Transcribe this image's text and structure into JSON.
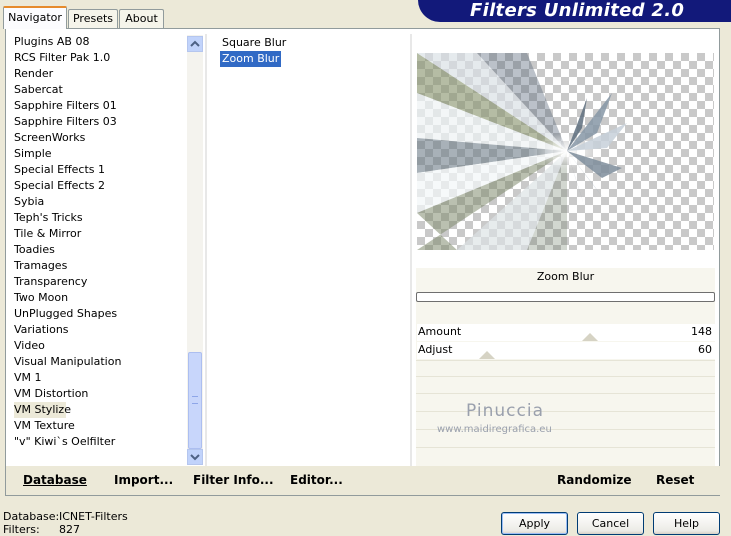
{
  "tabs": [
    {
      "label": "Navigator",
      "active": true
    },
    {
      "label": "Presets",
      "active": false
    },
    {
      "label": "About",
      "active": false
    }
  ],
  "brand_title": "Filters Unlimited 2.0",
  "categories": [
    {
      "label": "Plugins AB 08"
    },
    {
      "label": "RCS Filter Pak 1.0"
    },
    {
      "label": "Render"
    },
    {
      "label": "Sabercat"
    },
    {
      "label": "Sapphire Filters 01"
    },
    {
      "label": "Sapphire Filters 03"
    },
    {
      "label": "ScreenWorks"
    },
    {
      "label": "Simple"
    },
    {
      "label": "Special Effects 1"
    },
    {
      "label": "Special Effects 2"
    },
    {
      "label": "Sybia"
    },
    {
      "label": "Teph's Tricks"
    },
    {
      "label": "Tile & Mirror"
    },
    {
      "label": "Toadies"
    },
    {
      "label": "Tramages"
    },
    {
      "label": "Transparency"
    },
    {
      "label": "Two Moon"
    },
    {
      "label": "UnPlugged Shapes"
    },
    {
      "label": "Variations"
    },
    {
      "label": "Video"
    },
    {
      "label": "Visual Manipulation"
    },
    {
      "label": "VM 1"
    },
    {
      "label": "VM Distortion"
    },
    {
      "label": "VM Stylize",
      "selected": true
    },
    {
      "label": "VM Texture"
    },
    {
      "label": "\"v\" Kiwi`s Oelfilter"
    }
  ],
  "filters": [
    {
      "label": "Square Blur"
    },
    {
      "label": "Zoom Blur",
      "selected": true
    }
  ],
  "filter_name": "Zoom Blur",
  "params": [
    {
      "label": "Amount",
      "value": "148",
      "level": 0.58
    },
    {
      "label": "Adjust",
      "value": "60",
      "level": 0.235
    }
  ],
  "links": {
    "database": "Database",
    "import": "Import...",
    "filter_info": "Filter Info...",
    "editor": "Editor...",
    "randomize": "Randomize",
    "reset": "Reset"
  },
  "status": {
    "database_label": "Database:",
    "database_value": "ICNET-Filters",
    "filters_label": "Filters:",
    "filters_value": "827"
  },
  "buttons": {
    "apply": "Apply",
    "cancel": "Cancel",
    "help": "Help"
  },
  "watermark": {
    "name": "Pinuccia",
    "url": "www.maidiregrafica.eu"
  },
  "icons": {
    "scroll_up": "arrow-up-icon",
    "scroll_down": "arrow-down-icon",
    "thumb_grip": "grip-icon"
  },
  "colors": {
    "brand": "#12197a",
    "selection": "#316ac5",
    "tab_accent": "#e68b2c",
    "window_bg": "#ece9d8"
  }
}
